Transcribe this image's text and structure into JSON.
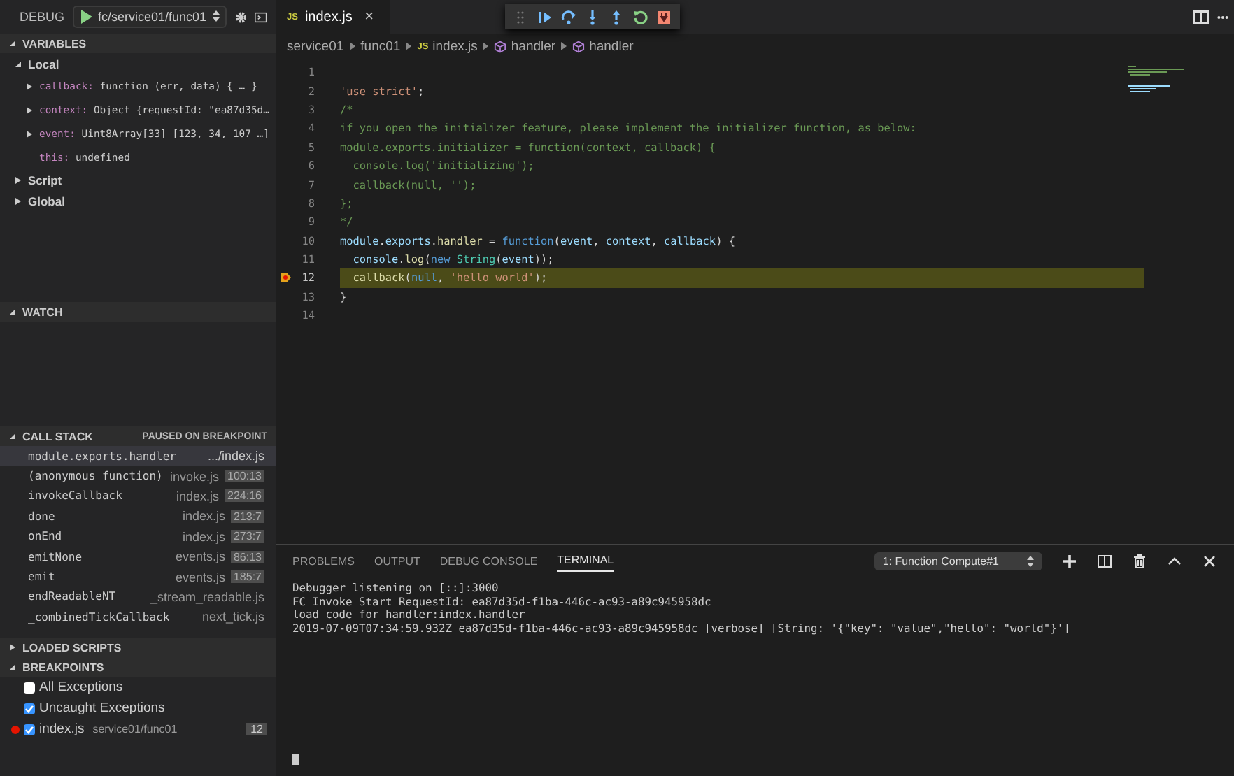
{
  "debug_bar": {
    "label": "DEBUG",
    "configuration": "fc/service01/func01"
  },
  "variables": {
    "title": "VARIABLES",
    "expanded": true,
    "scopes": [
      {
        "name": "Local",
        "expanded": true,
        "children": [
          {
            "name": "callback:",
            "value": "function (err, data) { … }",
            "expandable": true
          },
          {
            "name": "context:",
            "value": "Object {requestId: \"ea87d35d…",
            "expandable": true
          },
          {
            "name": "event:",
            "value": "Uint8Array[33] [123, 34, 107 …]",
            "expandable": true
          },
          {
            "name": "this:",
            "value": "undefined",
            "expandable": false
          }
        ]
      },
      {
        "name": "Script",
        "expanded": false
      },
      {
        "name": "Global",
        "expanded": false
      }
    ]
  },
  "watch": {
    "title": "WATCH",
    "expanded": true
  },
  "call_stack": {
    "title": "CALL STACK",
    "expanded": true,
    "status": "PAUSED ON BREAKPOINT",
    "frames": [
      {
        "name": "module.exports.handler",
        "file": ".../index.js",
        "selected": true
      },
      {
        "name": "(anonymous function)",
        "file": "invoke.js",
        "position": "100:13",
        "selected": false
      },
      {
        "name": "invokeCallback",
        "file": "index.js",
        "position": "224:16",
        "selected": false
      },
      {
        "name": "done",
        "file": "index.js",
        "position": "213:7",
        "selected": false
      },
      {
        "name": "onEnd",
        "file": "index.js",
        "position": "273:7",
        "selected": false
      },
      {
        "name": "emitNone",
        "file": "events.js",
        "position": "86:13",
        "selected": false
      },
      {
        "name": "emit",
        "file": "events.js",
        "position": "185:7",
        "selected": false
      },
      {
        "name": "endReadableNT",
        "file": "_stream_readable.js",
        "selected": false
      },
      {
        "name": "_combinedTickCallback",
        "file": "next_tick.js",
        "selected": false
      }
    ]
  },
  "loaded_scripts": {
    "title": "LOADED SCRIPTS",
    "expanded": false
  },
  "breakpoints": {
    "title": "BREAKPOINTS",
    "expanded": true,
    "items": [
      {
        "label": "All Exceptions",
        "checked": false
      },
      {
        "label": "Uncaught Exceptions",
        "checked": true
      },
      {
        "label": "index.js",
        "path": "service01/func01",
        "line": "12",
        "checked": true,
        "dot": true
      }
    ]
  },
  "editor": {
    "tab": {
      "title": "index.js",
      "badge": "JS",
      "close": "×"
    },
    "breadcrumb": [
      {
        "text": "service01",
        "kind": "folder"
      },
      {
        "text": "func01",
        "kind": "folder"
      },
      {
        "text": "index.js",
        "kind": "file",
        "badge": "JS"
      },
      {
        "text": "handler",
        "kind": "symbol"
      },
      {
        "text": "handler",
        "kind": "symbol"
      }
    ],
    "lines": [
      {
        "number": "1",
        "paused": false
      },
      {
        "number": "2",
        "paused": false,
        "tokens": [
          {
            "text": "'use strict'",
            "kind": "string"
          },
          {
            "text": ";",
            "kind": "plain"
          }
        ]
      },
      {
        "number": "3",
        "paused": false,
        "tokens": [
          {
            "text": "/*",
            "kind": "comment"
          }
        ]
      },
      {
        "number": "4",
        "paused": false,
        "tokens": [
          {
            "text": "if you open the initializer feature, please implement the initializer function, as below:",
            "kind": "comment"
          }
        ]
      },
      {
        "number": "5",
        "paused": false,
        "tokens": [
          {
            "text": "module.exports.initializer = function(context, callback) {",
            "kind": "comment"
          }
        ]
      },
      {
        "number": "6",
        "paused": false,
        "tokens": [
          {
            "text": "  console.log('initializing');",
            "kind": "comment"
          }
        ]
      },
      {
        "number": "7",
        "paused": false,
        "tokens": [
          {
            "text": "  callback(null, '');",
            "kind": "comment"
          }
        ]
      },
      {
        "number": "8",
        "paused": false,
        "tokens": [
          {
            "text": "};",
            "kind": "comment"
          }
        ]
      },
      {
        "number": "9",
        "paused": false,
        "tokens": [
          {
            "text": "*/",
            "kind": "comment"
          }
        ]
      },
      {
        "number": "10",
        "paused": false,
        "tokens": [
          {
            "text": "module",
            "kind": "variable"
          },
          {
            "text": ".",
            "kind": "plain"
          },
          {
            "text": "exports",
            "kind": "variable"
          },
          {
            "text": ".",
            "kind": "plain"
          },
          {
            "text": "handler",
            "kind": "function"
          },
          {
            "text": " = ",
            "kind": "plain"
          },
          {
            "text": "function",
            "kind": "keyword"
          },
          {
            "text": "(",
            "kind": "plain"
          },
          {
            "text": "event",
            "kind": "variable"
          },
          {
            "text": ", ",
            "kind": "plain"
          },
          {
            "text": "context",
            "kind": "variable"
          },
          {
            "text": ", ",
            "kind": "plain"
          },
          {
            "text": "callback",
            "kind": "variable"
          },
          {
            "text": ") {",
            "kind": "plain"
          }
        ]
      },
      {
        "number": "11",
        "paused": false,
        "tokens": [
          {
            "text": "  console",
            "kind": "variable"
          },
          {
            "text": ".",
            "kind": "plain"
          },
          {
            "text": "log",
            "kind": "function"
          },
          {
            "text": "(",
            "kind": "plain"
          },
          {
            "text": "new",
            "kind": "keyword"
          },
          {
            "text": " String",
            "kind": "type"
          },
          {
            "text": "(",
            "kind": "plain"
          },
          {
            "text": "event",
            "kind": "variable"
          },
          {
            "text": "));",
            "kind": "plain"
          }
        ]
      },
      {
        "number": "12",
        "paused": true,
        "tokens": [
          {
            "text": "  callback",
            "kind": "function"
          },
          {
            "text": "(",
            "kind": "plain"
          },
          {
            "text": "null",
            "kind": "keyword"
          },
          {
            "text": ", ",
            "kind": "plain"
          },
          {
            "text": "'hello world'",
            "kind": "string"
          },
          {
            "text": ");",
            "kind": "plain"
          }
        ]
      },
      {
        "number": "13",
        "paused": false,
        "tokens": [
          {
            "text": "}",
            "kind": "plain"
          }
        ]
      },
      {
        "number": "14",
        "paused": false
      }
    ]
  },
  "panel": {
    "tabs": [
      {
        "label": "PROBLEMS",
        "selected": false
      },
      {
        "label": "OUTPUT",
        "selected": false
      },
      {
        "label": "DEBUG CONSOLE",
        "selected": false
      },
      {
        "label": "TERMINAL",
        "selected": true
      }
    ],
    "terminal_select": "1: Function Compute#1",
    "terminal_lines": [
      "Debugger listening on [::]:3000",
      "FC Invoke Start RequestId: ea87d35d-f1ba-446c-ac93-a89c945958dc",
      "load code for handler:index.handler",
      "2019-07-09T07:34:59.932Z ea87d35d-f1ba-446c-ac93-a89c945958dc [verbose] [String: '{\"key\": \"value\",\"hello\": \"world\"}']"
    ]
  }
}
